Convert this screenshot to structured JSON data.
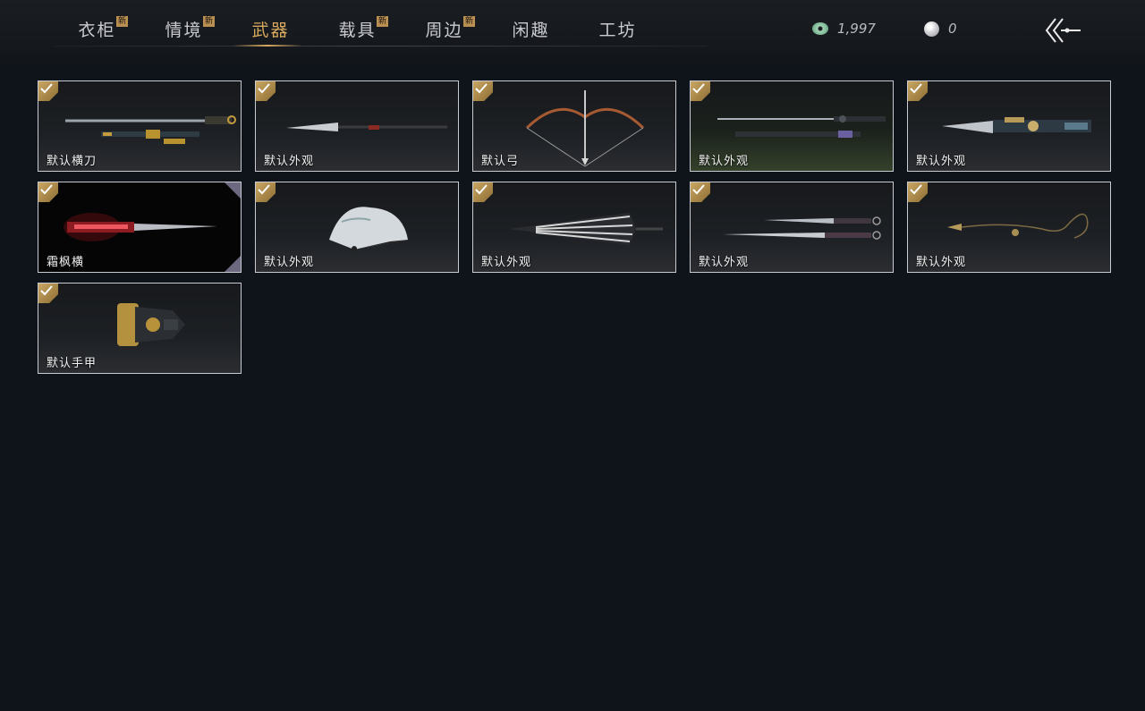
{
  "tabs": [
    {
      "label": "衣柜",
      "new": "新",
      "active": false
    },
    {
      "label": "情境",
      "new": "新",
      "active": false
    },
    {
      "label": "武器",
      "new": "",
      "active": true
    },
    {
      "label": "载具",
      "new": "新",
      "active": false
    },
    {
      "label": "周边",
      "new": "新",
      "active": false
    },
    {
      "label": "闲趣",
      "new": "",
      "active": false
    },
    {
      "label": "工坊",
      "new": "",
      "active": false
    }
  ],
  "currencies": {
    "jade": {
      "icon": "jade-coin-icon",
      "value": "1,997"
    },
    "pearl": {
      "icon": "pearl-icon",
      "value": "0"
    }
  },
  "back_icon": "back-arrow-icon",
  "accent_color": "#d9a95e",
  "items": [
    {
      "label": "默认横刀",
      "weapon": "saber",
      "equipped": true
    },
    {
      "label": "默认外观",
      "weapon": "spear",
      "equipped": true
    },
    {
      "label": "默认弓",
      "weapon": "bow",
      "equipped": true
    },
    {
      "label": "默认外观",
      "weapon": "twin-sword",
      "equipped": true
    },
    {
      "label": "默认外观",
      "weapon": "ornate-blade",
      "equipped": true
    },
    {
      "label": "霜枫横",
      "weapon": "crimson-saber",
      "equipped": true
    },
    {
      "label": "默认外观",
      "weapon": "fan",
      "equipped": true
    },
    {
      "label": "默认外观",
      "weapon": "umbrella",
      "equipped": true
    },
    {
      "label": "默认外观",
      "weapon": "dual-blades",
      "equipped": true
    },
    {
      "label": "默认外观",
      "weapon": "rope-dart",
      "equipped": true
    },
    {
      "label": "默认手甲",
      "weapon": "gauntlet",
      "equipped": true
    }
  ]
}
